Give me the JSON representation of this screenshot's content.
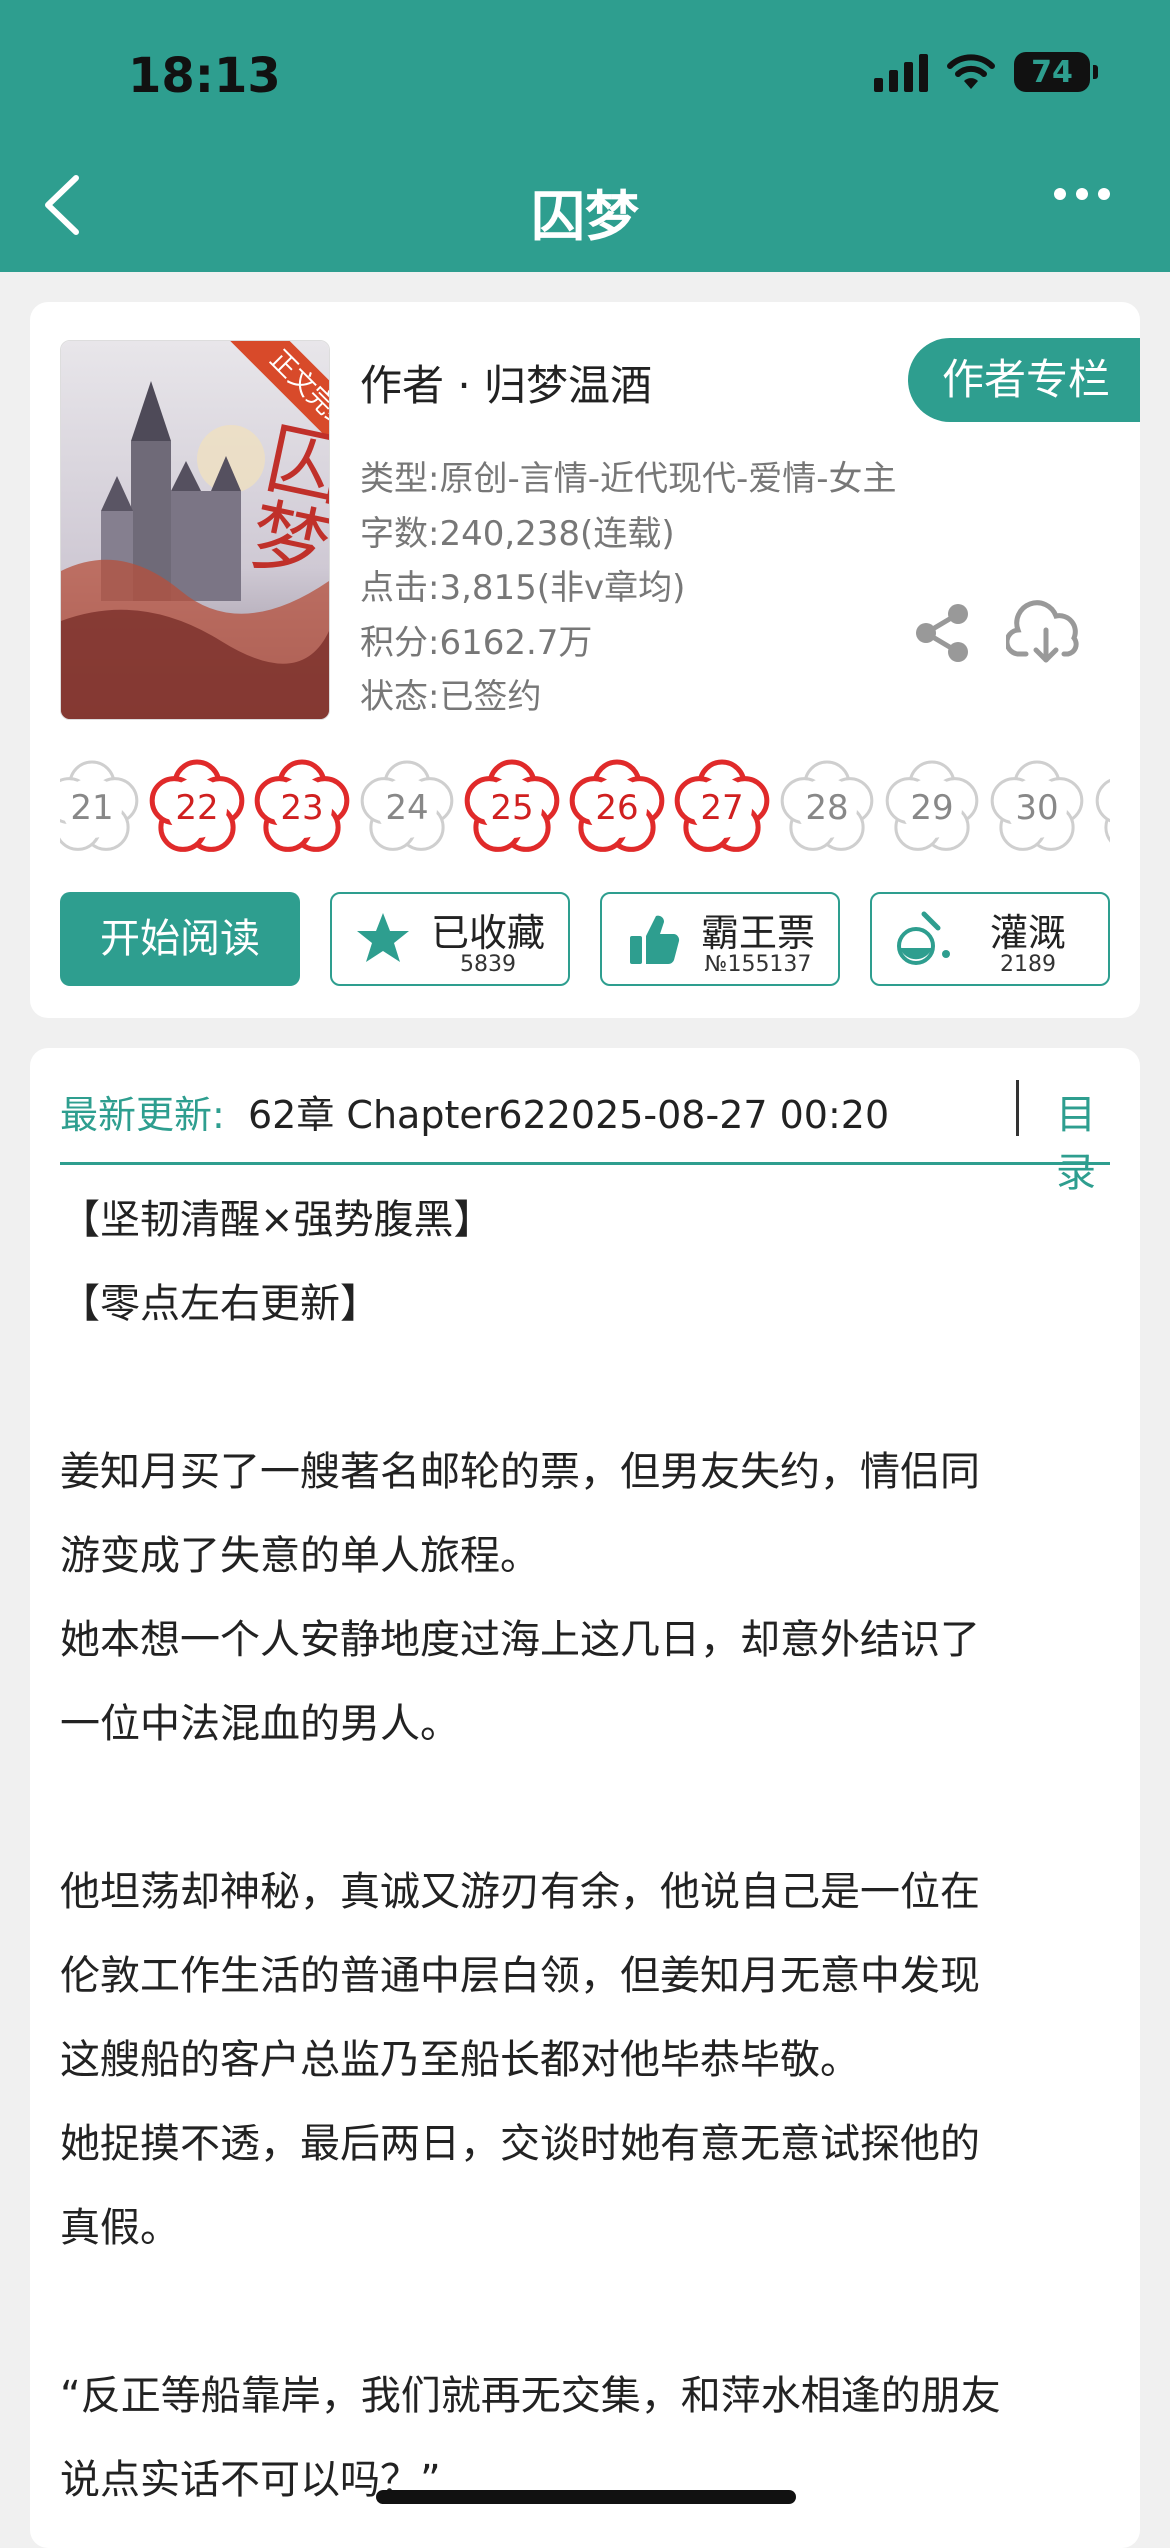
{
  "status_bar": {
    "time": "18:13",
    "battery": "74"
  },
  "nav": {
    "title": "囚梦"
  },
  "book": {
    "cover_tag": "正文完结",
    "cover_title": "囚梦",
    "author": "作者 · 归梦温酒",
    "author_column_btn": "作者专栏",
    "type": "类型:原创-言情-近代现代-爱情-女主",
    "words": "字数:240,238(连载)",
    "clicks": "点击:3,815(非v章均)",
    "score": "积分:6162.7万",
    "status": "状态:已签约"
  },
  "chapters": [
    {
      "n": "21",
      "red": false
    },
    {
      "n": "22",
      "red": true
    },
    {
      "n": "23",
      "red": true
    },
    {
      "n": "24",
      "red": false
    },
    {
      "n": "25",
      "red": true
    },
    {
      "n": "26",
      "red": true
    },
    {
      "n": "27",
      "red": true
    },
    {
      "n": "28",
      "red": false
    },
    {
      "n": "29",
      "red": false
    },
    {
      "n": "30",
      "red": false
    }
  ],
  "actions": {
    "read": "开始阅读",
    "collect": {
      "label": "已收藏",
      "count": "5839"
    },
    "bawang": {
      "label": "霸王票",
      "count": "№155137"
    },
    "guangai": {
      "label": "灌溉",
      "count": "2189"
    }
  },
  "update": {
    "label": "最新更新:",
    "text": "62章 Chapter622025-08-27 00:20",
    "toc": "目录"
  },
  "description": [
    "【坚韧清醒×强势腹黑】",
    "【零点左右更新】",
    "",
    "姜知月买了一艘著名邮轮的票，但男友失约，情侣同",
    "游变成了失意的单人旅程。",
    "她本想一个人安静地度过海上这几日，却意外结识了",
    "一位中法混血的男人。",
    "",
    "他坦荡却神秘，真诚又游刃有余，他说自己是一位在",
    "伦敦工作生活的普通中层白领，但姜知月无意中发现",
    "这艘船的客户总监乃至船长都对他毕恭毕敬。",
    "她捉摸不透，最后两日，交谈时她有意无意试探他的",
    "真假。",
    "",
    "“反正等船靠岸，我们就再无交集，和萍水相逢的朋友",
    "说点实话不可以吗？”"
  ]
}
